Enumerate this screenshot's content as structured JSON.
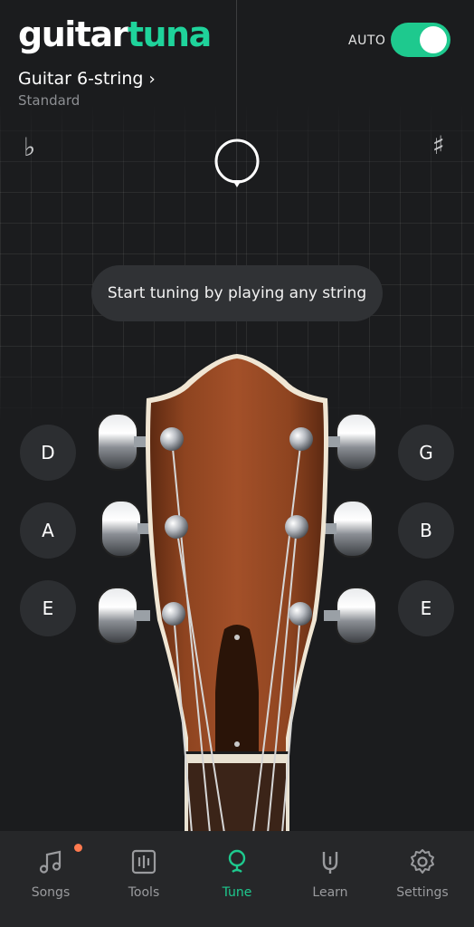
{
  "header": {
    "logo_part1": "guitar",
    "logo_part2": "tuna",
    "auto_label": "AUTO",
    "auto_enabled": true,
    "instrument": "Guitar 6-string",
    "tuning": "Standard"
  },
  "tuner": {
    "flat_symbol": "♭",
    "sharp_symbol": "♯",
    "hint": "Start tuning by playing any string"
  },
  "strings": {
    "left": [
      "D",
      "A",
      "E"
    ],
    "right": [
      "G",
      "B",
      "E"
    ]
  },
  "tabs": [
    {
      "label": "Songs",
      "icon": "music-note-icon",
      "badge": true
    },
    {
      "label": "Tools",
      "icon": "tools-icon"
    },
    {
      "label": "Tune",
      "icon": "tune-icon",
      "active": true
    },
    {
      "label": "Learn",
      "icon": "learn-icon"
    },
    {
      "label": "Settings",
      "icon": "gear-icon"
    }
  ],
  "colors": {
    "accent": "#1ec98e",
    "background": "#1b1c1e",
    "badge": "#ff7a4f",
    "wood": "#8a3f1f"
  }
}
